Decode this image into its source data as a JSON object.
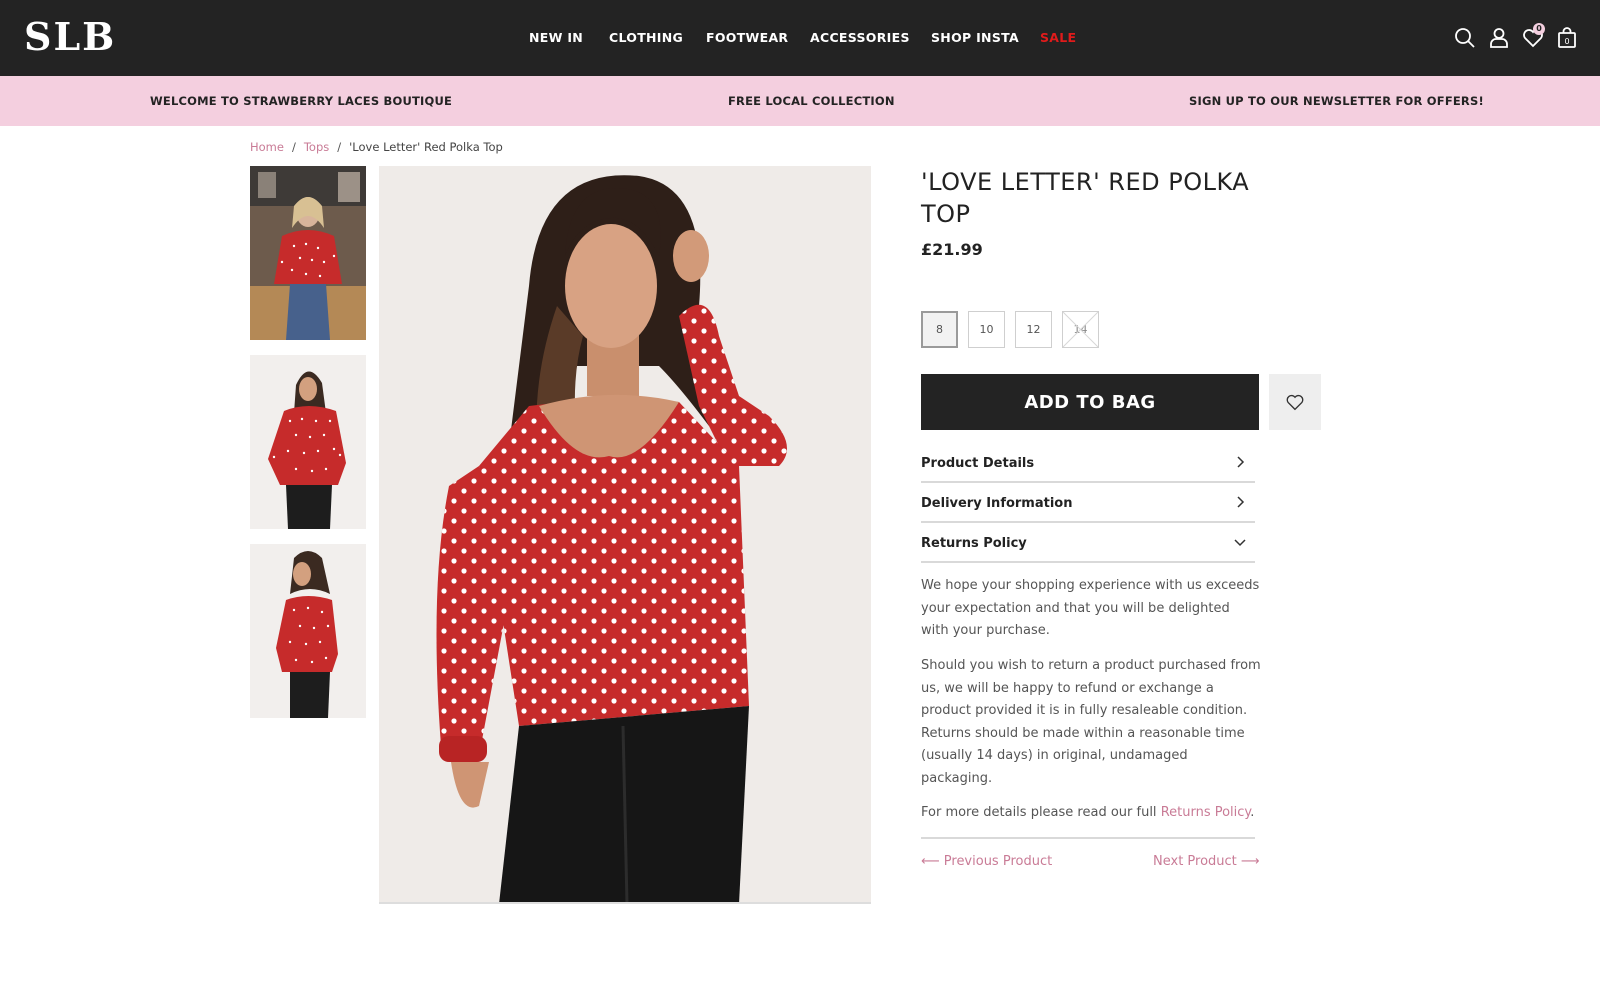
{
  "header": {
    "logo": "SLB",
    "nav": [
      "NEW IN",
      "CLOTHING",
      "FOOTWEAR",
      "ACCESSORIES",
      "SHOP INSTA",
      "SALE"
    ],
    "wishlist_count": "0",
    "bag_count": "0"
  },
  "promo": {
    "left": "WELCOME TO STRAWBERRY LACES BOUTIQUE",
    "center": "FREE LOCAL COLLECTION",
    "right": "SIGN UP TO OUR NEWSLETTER FOR OFFERS!"
  },
  "breadcrumb": {
    "home": "Home",
    "category": "Tops",
    "current": "'Love Letter' Red Polka Top",
    "separator": "/"
  },
  "product": {
    "title": "'LOVE LETTER' RED POLKA TOP",
    "price": "£21.99",
    "sizes": [
      {
        "label": "8",
        "state": "selected"
      },
      {
        "label": "10",
        "state": "available"
      },
      {
        "label": "12",
        "state": "available"
      },
      {
        "label": "14",
        "state": "unavailable"
      }
    ],
    "add_to_bag": "ADD TO BAG",
    "accordion": {
      "product_details": "Product Details",
      "delivery_information": "Delivery Information",
      "returns_policy": "Returns Policy"
    },
    "returns": {
      "para1": "We hope your shopping experience with us exceeds your expectation and that you will be delighted with your purchase.",
      "para2": "Should you wish to return a product purchased from us, we will be happy to refund or exchange a product provided it is in fully resaleable condition. Returns should be made within a reasonable time (usually 14 days) in original, undamaged packaging.",
      "para3_prefix": "For more details please read our full ",
      "para3_link": "Returns Policy",
      "para3_suffix": "."
    },
    "prev_product": "⟵ Previous Product",
    "next_product": "Next Product ⟶"
  },
  "colors": {
    "header_bg": "#232323",
    "promo_bg": "#f4cfdf",
    "accent_pink": "#c97b96",
    "sale_red": "#e01b1b",
    "top_red": "#c62b2b"
  },
  "icons": [
    "search-icon",
    "account-icon",
    "heart-icon",
    "bag-icon",
    "chevron-right-icon",
    "chevron-down-icon"
  ]
}
